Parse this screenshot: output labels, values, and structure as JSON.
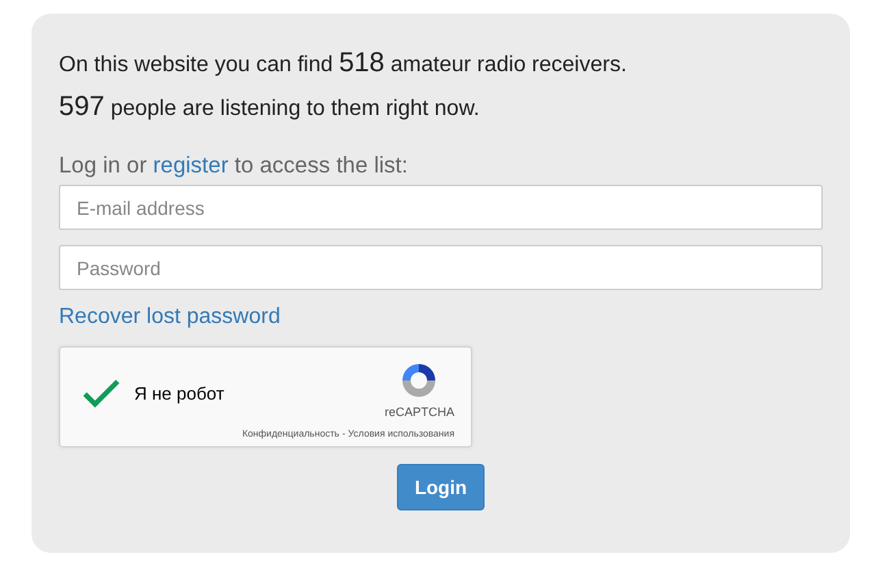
{
  "intro": [
    {
      "before": "On this website you can find ",
      "count": "518",
      "after": " amateur radio receivers."
    },
    {
      "count": "597",
      "after": " people are listening to them right now."
    }
  ],
  "login_prompt": {
    "before": "Log in or ",
    "link": "register",
    "after": " to access the list:"
  },
  "fields": [
    {
      "placeholder": "E-mail address"
    },
    {
      "placeholder": "Password"
    }
  ],
  "recover_link": "Recover lost password",
  "captcha": {
    "checked": true,
    "label": "Я не робот",
    "brand": "reCAPTCHA",
    "privacy": "Конфиденциальность",
    "separator": "-",
    "terms": "Условия использования"
  },
  "button": "Login"
}
